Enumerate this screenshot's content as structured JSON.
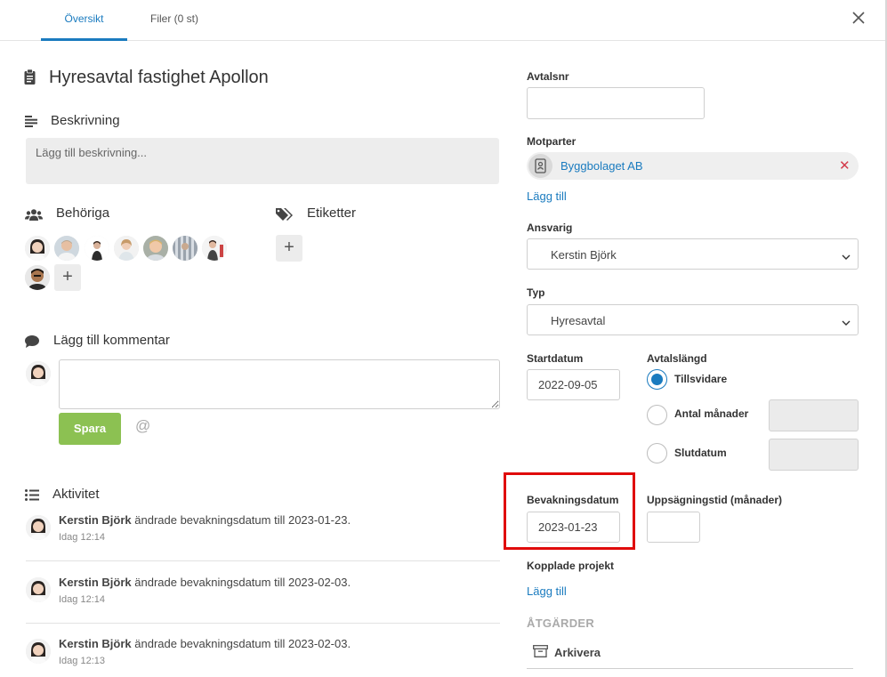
{
  "tabs": [
    {
      "label": "Översikt",
      "active": true
    },
    {
      "label": "Filer (0 st)",
      "active": false
    }
  ],
  "close_icon": "close-icon",
  "colors": {
    "accent": "#1a7bbf",
    "save_button": "#8cc152",
    "highlight": "#e00b0b",
    "remove": "#d33a4a"
  },
  "main": {
    "title": "Hyresavtal fastighet Apollon",
    "description": {
      "heading": "Beskrivning",
      "placeholder": "Lägg till beskrivning..."
    },
    "authorized": {
      "heading": "Behöriga",
      "avatar_count": 8
    },
    "labels": {
      "heading": "Etiketter"
    },
    "comment": {
      "heading": "Lägg till kommentar",
      "save_label": "Spara",
      "mention_symbol": "@"
    },
    "activity": {
      "heading": "Aktivitet",
      "items": [
        {
          "user": "Kerstin Björk",
          "text": " ändrade bevakningsdatum till 2023-01-23.",
          "time": "Idag 12:14"
        },
        {
          "user": "Kerstin Björk",
          "text": " ändrade bevakningsdatum till 2023-02-03.",
          "time": "Idag 12:14"
        },
        {
          "user": "Kerstin Björk",
          "text": " ändrade bevakningsdatum till 2023-02-03.",
          "time": "Idag 12:13"
        }
      ]
    }
  },
  "side": {
    "contract_no": {
      "label": "Avtalsnr",
      "value": ""
    },
    "counterparts": {
      "label": "Motparter",
      "items": [
        {
          "name": "Byggbolaget AB"
        }
      ],
      "add_label": "Lägg till"
    },
    "responsible": {
      "label": "Ansvarig",
      "value": "Kerstin Björk"
    },
    "type": {
      "label": "Typ",
      "value": "Hyresavtal"
    },
    "start_date": {
      "label": "Startdatum",
      "value": "2022-09-05"
    },
    "duration": {
      "label": "Avtalslängd",
      "options": [
        {
          "label": "Tillsvidare",
          "checked": true
        },
        {
          "label": "Antal månader",
          "checked": false
        },
        {
          "label": "Slutdatum",
          "checked": false
        }
      ]
    },
    "watch_date": {
      "label": "Bevakningsdatum",
      "value": "2023-01-23"
    },
    "notice_period": {
      "label": "Uppsägningstid (månader)",
      "value": ""
    },
    "linked_projects": {
      "label": "Kopplade projekt",
      "add_label": "Lägg till"
    },
    "actions": {
      "title": "ÅTGÄRDER",
      "archive_label": "Arkivera"
    }
  }
}
